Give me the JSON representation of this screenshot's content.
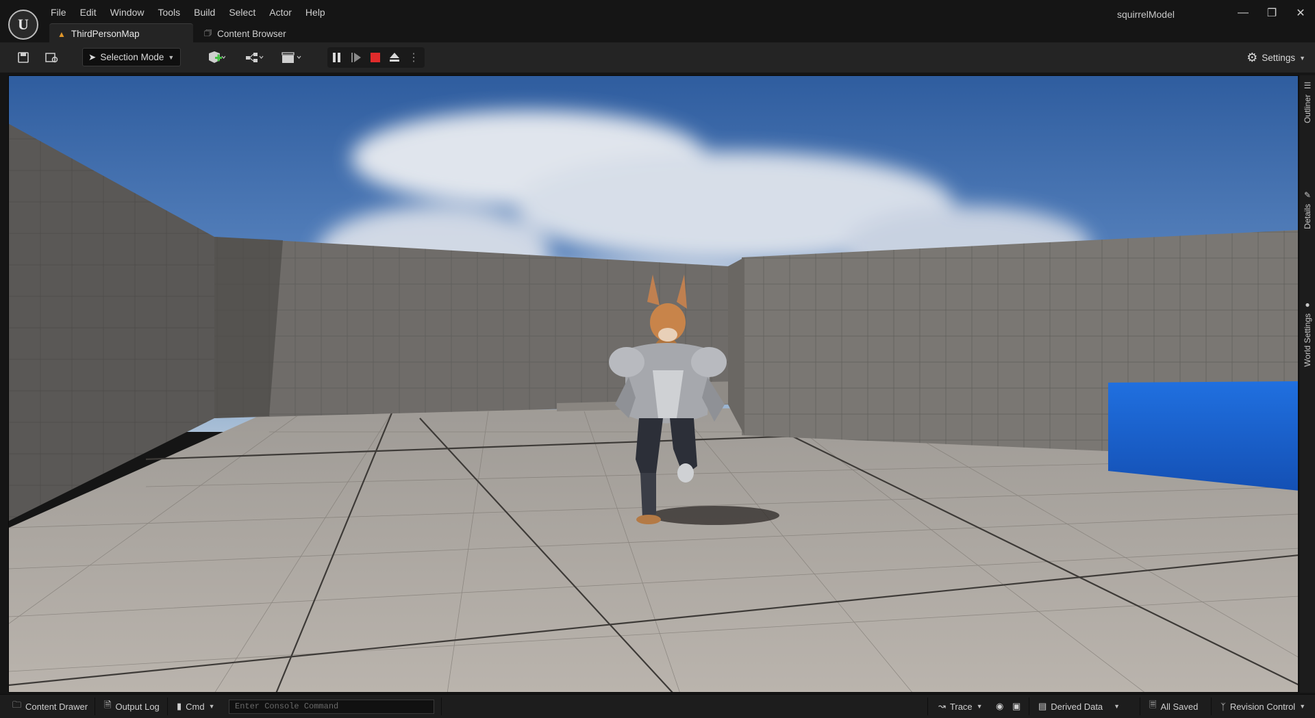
{
  "menu": {
    "items": [
      "File",
      "Edit",
      "Window",
      "Tools",
      "Build",
      "Select",
      "Actor",
      "Help"
    ]
  },
  "window": {
    "project_name": "squirrelModel",
    "minimize_icon": "minimize-icon",
    "restore_icon": "restore-icon",
    "close_icon": "close-icon"
  },
  "tabs": [
    {
      "label": "ThirdPersonMap",
      "active": true,
      "icon": "level-icon"
    },
    {
      "label": "Content Browser",
      "active": false,
      "icon": "content-browser-icon"
    }
  ],
  "toolbar": {
    "selection_mode": "Selection Mode",
    "settings_label": "Settings",
    "play_controls": [
      "pause",
      "skip-frame",
      "stop",
      "eject",
      "more"
    ],
    "stop_color": "#e02b2b"
  },
  "side_panels": [
    "Outliner",
    "Details",
    "World Settings"
  ],
  "statusbar": {
    "content_drawer": "Content Drawer",
    "output_log": "Output Log",
    "cmd": "Cmd",
    "console_placeholder": "Enter Console Command",
    "trace": "Trace",
    "derived_data": "Derived Data",
    "all_saved": "All Saved",
    "revision_control": "Revision Control"
  },
  "scene": {
    "sky_color": "#3f6fb0",
    "floor_color": "#b3ada6",
    "wall_color": "#6e6c6a",
    "cube_color": "#1b5fd0",
    "character": "armored squirrel"
  }
}
